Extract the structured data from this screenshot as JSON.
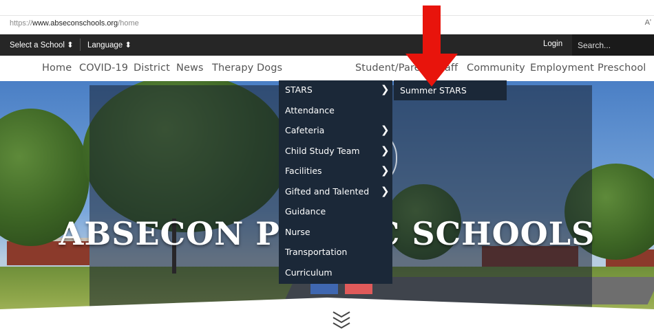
{
  "browser": {
    "url_prefix": "https://",
    "url_host": "www.abseconschools.org",
    "url_path": "/home",
    "reader_icon": "Aʹ"
  },
  "utility_bar": {
    "select_school": "Select a School ⬍",
    "language": "Language ⬍",
    "login": "Login",
    "search_placeholder": "Search..."
  },
  "nav": {
    "items": [
      "Home",
      "COVID-19",
      "District",
      "News",
      "Therapy Dogs",
      "Student/Parent/Staff",
      "Community",
      "Employment",
      "Preschool"
    ]
  },
  "hero": {
    "title": "ABSECON PUBLIC SCHOOLS"
  },
  "dropdown": {
    "items": [
      {
        "label": "STARS",
        "has_submenu": true
      },
      {
        "label": "Attendance",
        "has_submenu": false
      },
      {
        "label": "Cafeteria",
        "has_submenu": true
      },
      {
        "label": "Child Study Team",
        "has_submenu": true
      },
      {
        "label": "Facilities",
        "has_submenu": true
      },
      {
        "label": "Gifted and Talented",
        "has_submenu": true
      },
      {
        "label": "Guidance",
        "has_submenu": false
      },
      {
        "label": "Nurse",
        "has_submenu": false
      },
      {
        "label": "Transportation",
        "has_submenu": false
      },
      {
        "label": "Curriculum",
        "has_submenu": false
      }
    ],
    "submenu_arrow": "❯"
  },
  "submenu": {
    "items": [
      "Summer STARS"
    ]
  },
  "colors": {
    "menu_bg": "#1b2838",
    "utility_bg": "#262626",
    "annotation_arrow": "#e8140c"
  }
}
